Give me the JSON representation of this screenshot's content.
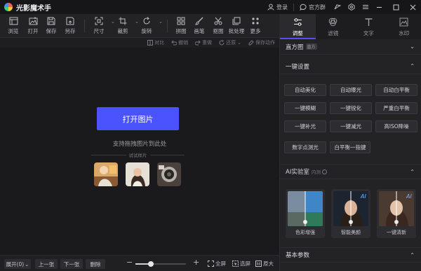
{
  "app": {
    "title": "光影魔术手"
  },
  "titlebar": {
    "login": "登录",
    "official_group": "官方群"
  },
  "toolbar": {
    "browse": "浏览",
    "open": "打开",
    "save": "保存",
    "save_as": "另存",
    "size": "尺寸",
    "crop": "裁剪",
    "rotate": "旋转",
    "collage": "拼图",
    "paint": "画笔",
    "cutout": "抠图",
    "batch": "批处理",
    "more": "更多"
  },
  "subtoolbar": {
    "compare": "对比",
    "undo": "撤销",
    "redo": "重做",
    "restore": "还原",
    "save_action": "保存动作"
  },
  "canvas": {
    "open_button": "打开图片",
    "drag_hint": "支持拖拽图片到此处",
    "sample_label": "试试样片"
  },
  "bottombar": {
    "fit": "展开(0)",
    "prev": "上一张",
    "next": "下一张",
    "delete": "删除",
    "zoom_level": 0.3,
    "fullscreen": "全屏",
    "select": "选屏",
    "original": "原大"
  },
  "panel": {
    "tabs": [
      {
        "label": "调整",
        "icon": "sliders-icon"
      },
      {
        "label": "滤镜",
        "icon": "filter-icon"
      },
      {
        "label": "文字",
        "icon": "text-icon"
      },
      {
        "label": "水印",
        "icon": "watermark-icon"
      }
    ],
    "histogram": {
      "title": "直方图",
      "badge": "直方"
    },
    "one_click": {
      "title": "一键设置",
      "buttons": [
        "自动美化",
        "自动曝光",
        "自动白平衡",
        "一键模糊",
        "一键锐化",
        "严重白平衡",
        "一键补光",
        "一键减光",
        "高ISO降噪",
        "数字点测光",
        "白平衡一指键"
      ]
    },
    "ai_lab": {
      "title": "AI实验室",
      "badge": "内测",
      "cards": [
        "色彩增强",
        "智能美颜",
        "一键清新"
      ]
    },
    "basic_params": {
      "title": "基本参数"
    }
  },
  "colors": {
    "accent": "#4b53ff",
    "panel_bg": "#232326",
    "canvas_bg": "#1a1a1c"
  }
}
